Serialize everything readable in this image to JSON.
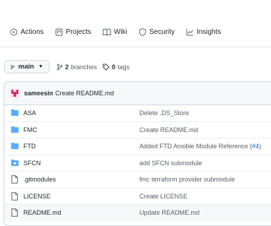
{
  "nav": {
    "tabs": [
      {
        "label": "Actions",
        "icon": "play-circle-icon"
      },
      {
        "label": "Projects",
        "icon": "project-board-icon"
      },
      {
        "label": "Wiki",
        "icon": "book-icon"
      },
      {
        "label": "Security",
        "icon": "shield-icon"
      },
      {
        "label": "Insights",
        "icon": "graph-icon"
      }
    ]
  },
  "branch": {
    "current": "main",
    "branches_count": "2",
    "branches_label": "branches",
    "tags_count": "0",
    "tags_label": "tags"
  },
  "commit": {
    "author": "sameesin",
    "message": "Create README.md"
  },
  "files": [
    {
      "type": "dir",
      "name": "ASA",
      "commit": "Delete .DS_Store",
      "pr": ""
    },
    {
      "type": "dir",
      "name": "FMC",
      "commit": "Create README.md",
      "pr": ""
    },
    {
      "type": "dir",
      "name": "FTD",
      "commit": "Added FTD Ansible Module Reference (",
      "pr": "#4",
      "suffix": ")"
    },
    {
      "type": "submodule",
      "name": "SFCN",
      "commit": "add SFCN submodule",
      "pr": ""
    },
    {
      "type": "file",
      "name": ".gitmodules",
      "commit": "fmc terraform provider submodule",
      "pr": ""
    },
    {
      "type": "file",
      "name": "LICENSE",
      "commit": "Create LICENSE",
      "pr": ""
    },
    {
      "type": "file",
      "name": "README.md",
      "commit": "Update README.md",
      "pr": ""
    }
  ],
  "colors": {
    "folder": "#54aeff",
    "accent": "#0969da",
    "muted": "#57606a"
  }
}
